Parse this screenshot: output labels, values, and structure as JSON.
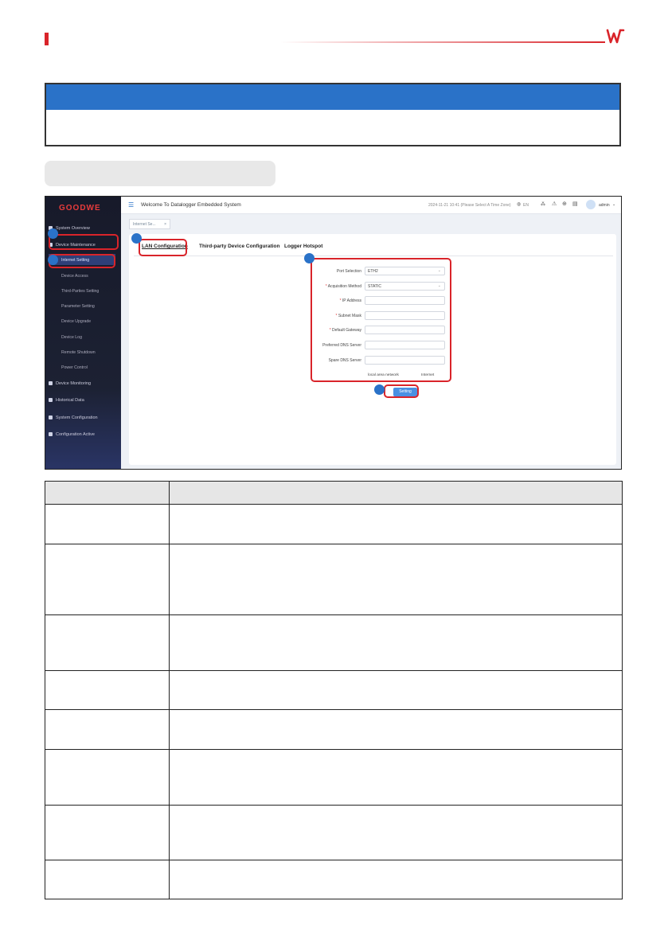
{
  "screenshot": {
    "brand": "GOODWE",
    "window_title": "Welcome To Datalogger Embedded System",
    "datetime": "2024-11-21 10:41 (Please Select A Time Zone)",
    "language": "EN",
    "user": "admin",
    "open_tab": "Internet Se...",
    "sidebar": [
      {
        "label": "System Overview"
      },
      {
        "label": "Device Maintenance"
      },
      {
        "label": "Internet Setting"
      },
      {
        "label": "Device Access"
      },
      {
        "label": "Third-Parties Setting"
      },
      {
        "label": "Parameter Setting"
      },
      {
        "label": "Device Upgrade"
      },
      {
        "label": "Device Log"
      },
      {
        "label": "Remote Shutdown"
      },
      {
        "label": "Power Control"
      },
      {
        "label": "Device Monitoring"
      },
      {
        "label": "Historical Data"
      },
      {
        "label": "System Configuration"
      },
      {
        "label": "Configuration Active"
      }
    ],
    "panel_tabs": [
      "LAN Configuration",
      "Third-party Device Configuration",
      "Logger Hotspot"
    ],
    "form": [
      {
        "label": "Port Selection",
        "value": "ETH2",
        "required": false,
        "dropdown": true
      },
      {
        "label": "Acquisition Method",
        "value": "STATIC",
        "required": true,
        "dropdown": true
      },
      {
        "label": "IP Address",
        "value": "",
        "required": true,
        "dropdown": false
      },
      {
        "label": "Subnet Mask",
        "value": "",
        "required": true,
        "dropdown": false
      },
      {
        "label": "Default Gateway",
        "value": "",
        "required": true,
        "dropdown": false
      },
      {
        "label": "Preferred DNS Server",
        "value": "",
        "required": false,
        "dropdown": false
      },
      {
        "label": "Spare DNS Server",
        "value": "",
        "required": false,
        "dropdown": false
      }
    ],
    "network_labels": [
      "local area network",
      "Internet"
    ],
    "setting_button": "Setting"
  },
  "colors": {
    "brand_red": "#d9242a",
    "note_blue": "#2a72c8",
    "sidebar_dark": "#1c2133",
    "button_blue": "#4a90e2"
  }
}
